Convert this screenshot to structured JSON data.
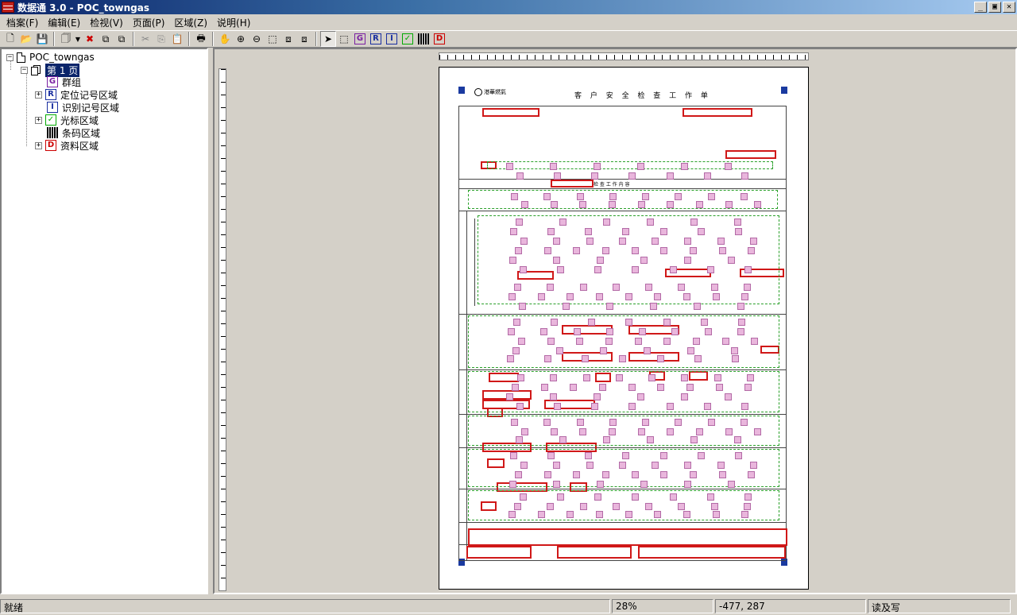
{
  "window": {
    "title": "数据通 3.0 - POC_towngas",
    "controls": [
      "_",
      "▣",
      "✕"
    ]
  },
  "menu": [
    "档案(F)",
    "编辑(E)",
    "检视(V)",
    "页面(P)",
    "区域(Z)",
    "说明(H)"
  ],
  "toolbar": {
    "buttons": [
      "new",
      "open",
      "save",
      "copy-page",
      "dropdown",
      "delete",
      "duplicate",
      "duplicate-2",
      "cut",
      "copy",
      "paste",
      "print",
      "hand",
      "zoom-in",
      "zoom-out",
      "fit",
      "move-a",
      "move-b",
      "select",
      "rectangle",
      "G",
      "R",
      "I",
      "check",
      "barcode",
      "D"
    ],
    "letter_buttons": {
      "g": "G",
      "r": "R",
      "i": "I",
      "d": "D"
    }
  },
  "tree": {
    "root": "POC_towngas",
    "page": "第 1 页",
    "items": [
      {
        "label": "群组",
        "icon": "G",
        "expandable": false
      },
      {
        "label": "定位记号区域",
        "icon": "R",
        "expandable": true
      },
      {
        "label": "识别记号区域",
        "icon": "I",
        "expandable": false
      },
      {
        "label": "光标区域",
        "icon": "check",
        "expandable": true
      },
      {
        "label": "条码区域",
        "icon": "barcode",
        "expandable": false
      },
      {
        "label": "资料区域",
        "icon": "D",
        "expandable": true
      }
    ]
  },
  "document": {
    "title": "客 户 安 全 检 查 工 作 单",
    "logo": "港華燃氣",
    "section": "检 查 工 作 内 容"
  },
  "status": {
    "message": "就绪",
    "zoom": "28%",
    "coords": "-477, 287",
    "mode": "读及写"
  },
  "colors": {
    "titlebar": "#0a246a",
    "selection": "#0a246a",
    "data_region": "#d01818",
    "mark_region": "#e9b6dc",
    "omr_outline": "#2aa02a"
  }
}
